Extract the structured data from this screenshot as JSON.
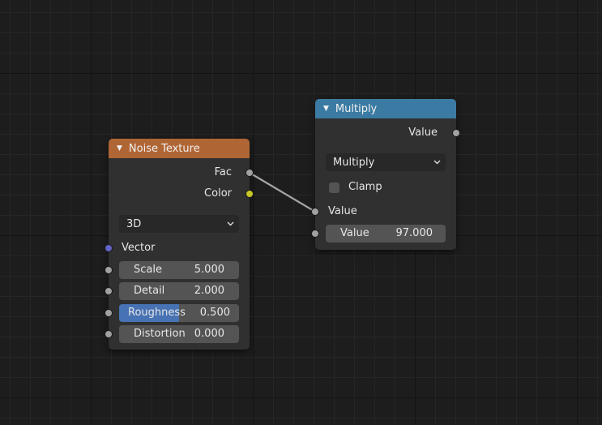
{
  "link_color": "#a5a5a5",
  "noise_node": {
    "title": "Noise Texture",
    "header_color": "#b06634",
    "outputs": {
      "fac": "Fac",
      "color": "Color"
    },
    "dimension_dropdown": "3D",
    "vector_label": "Vector",
    "fields": [
      {
        "label": "Scale",
        "value": "5.000",
        "fill": 0
      },
      {
        "label": "Detail",
        "value": "2.000",
        "fill": 0
      },
      {
        "label": "Roughness",
        "value": "0.500",
        "fill": 0.5
      },
      {
        "label": "Distortion",
        "value": "0.000",
        "fill": 0
      }
    ],
    "socket_colors": {
      "float": "#a1a1a1",
      "color": "#c7c729",
      "vector": "#6363c7"
    }
  },
  "multiply_node": {
    "title": "Multiply",
    "header_color": "#3b7ba3",
    "output_label": "Value",
    "operation_dropdown": "Multiply",
    "clamp_label": "Clamp",
    "clamp_checked": false,
    "input_label": "Value",
    "field": {
      "label": "Value",
      "value": "97.000"
    }
  }
}
